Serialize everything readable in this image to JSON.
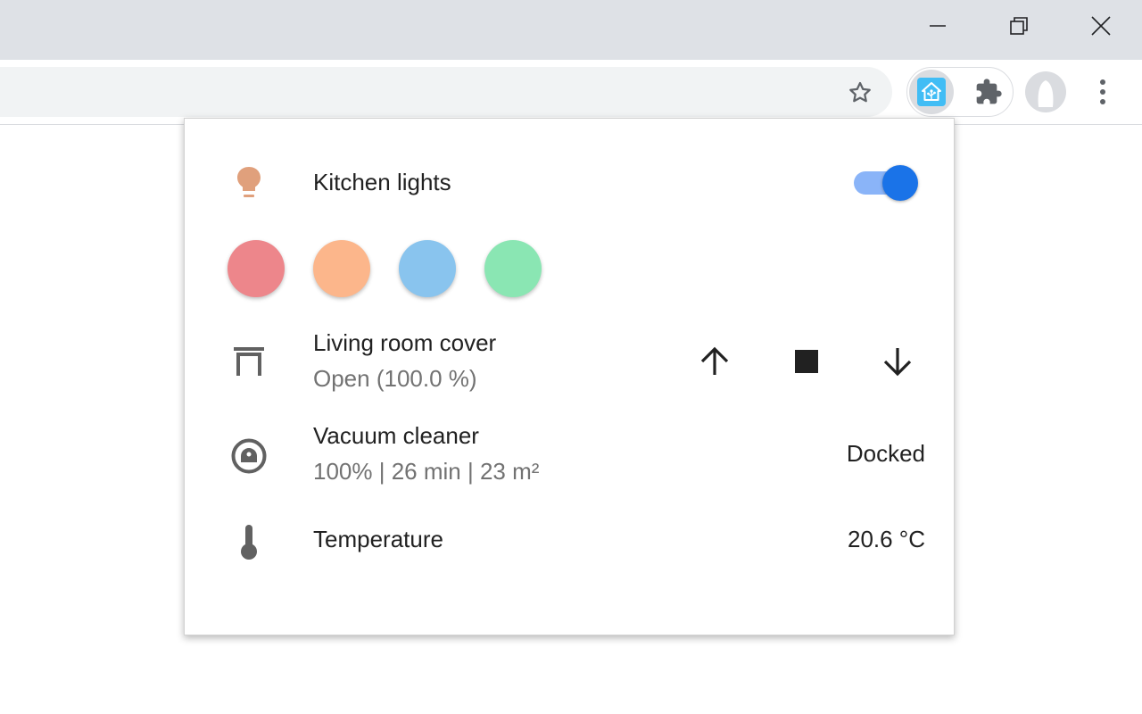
{
  "browser": {
    "icons": {
      "minimize": "minimize-icon",
      "restore": "restore-icon",
      "close": "close-icon",
      "bookmark": "star-outline-icon",
      "extension_home_assistant": "home-assistant-icon",
      "extensions": "puzzle-icon",
      "profile": "avatar-icon",
      "menu": "kebab-menu-icon"
    }
  },
  "popup": {
    "kitchen_lights": {
      "name": "Kitchen lights",
      "icon": "lightbulb-icon",
      "icon_color": "#e0a07c",
      "on": true,
      "color_presets": [
        {
          "name": "red",
          "color": "#ed868b"
        },
        {
          "name": "orange",
          "color": "#fcb68b"
        },
        {
          "name": "blue",
          "color": "#89c4ee"
        },
        {
          "name": "green",
          "color": "#8ae6b3"
        }
      ]
    },
    "cover": {
      "name": "Living room cover",
      "status": "Open (100.0 %)",
      "icon": "window-cover-icon",
      "buttons": [
        "arrow-up-icon",
        "stop-icon",
        "arrow-down-icon"
      ]
    },
    "vacuum": {
      "name": "Vacuum cleaner",
      "details": "100% | 26 min | 23 m²",
      "state": "Docked",
      "icon": "robot-vacuum-icon"
    },
    "temperature": {
      "name": "Temperature",
      "value": "20.6 °C",
      "icon": "thermometer-icon"
    }
  },
  "colors": {
    "accent": "#1a73e8",
    "accent_light": "#8ab4f8",
    "titlebar": "#dee1e6",
    "omnibox": "#f1f3f4",
    "home_assistant": "#41bdf5"
  }
}
